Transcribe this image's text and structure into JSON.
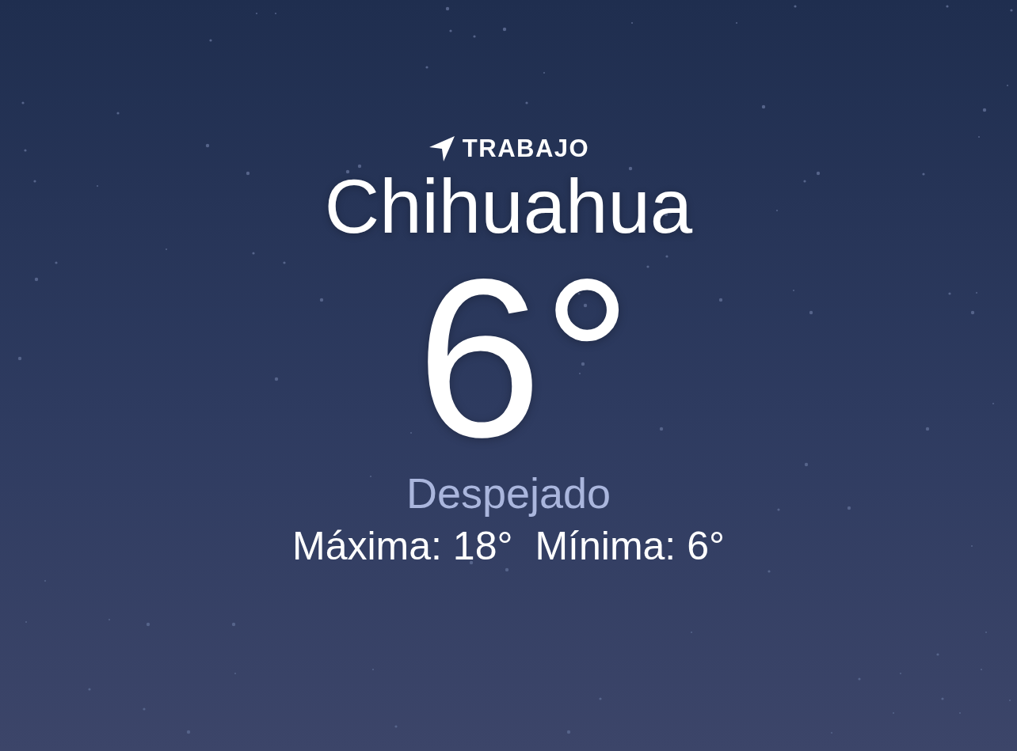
{
  "location": {
    "label": "TRABAJO",
    "city": "Chihuahua"
  },
  "current": {
    "temperature": "6°",
    "condition": "Despejado"
  },
  "range": [
    {
      "text": "Máxima: 18°"
    },
    {
      "text": "Mínima: 6°"
    }
  ]
}
